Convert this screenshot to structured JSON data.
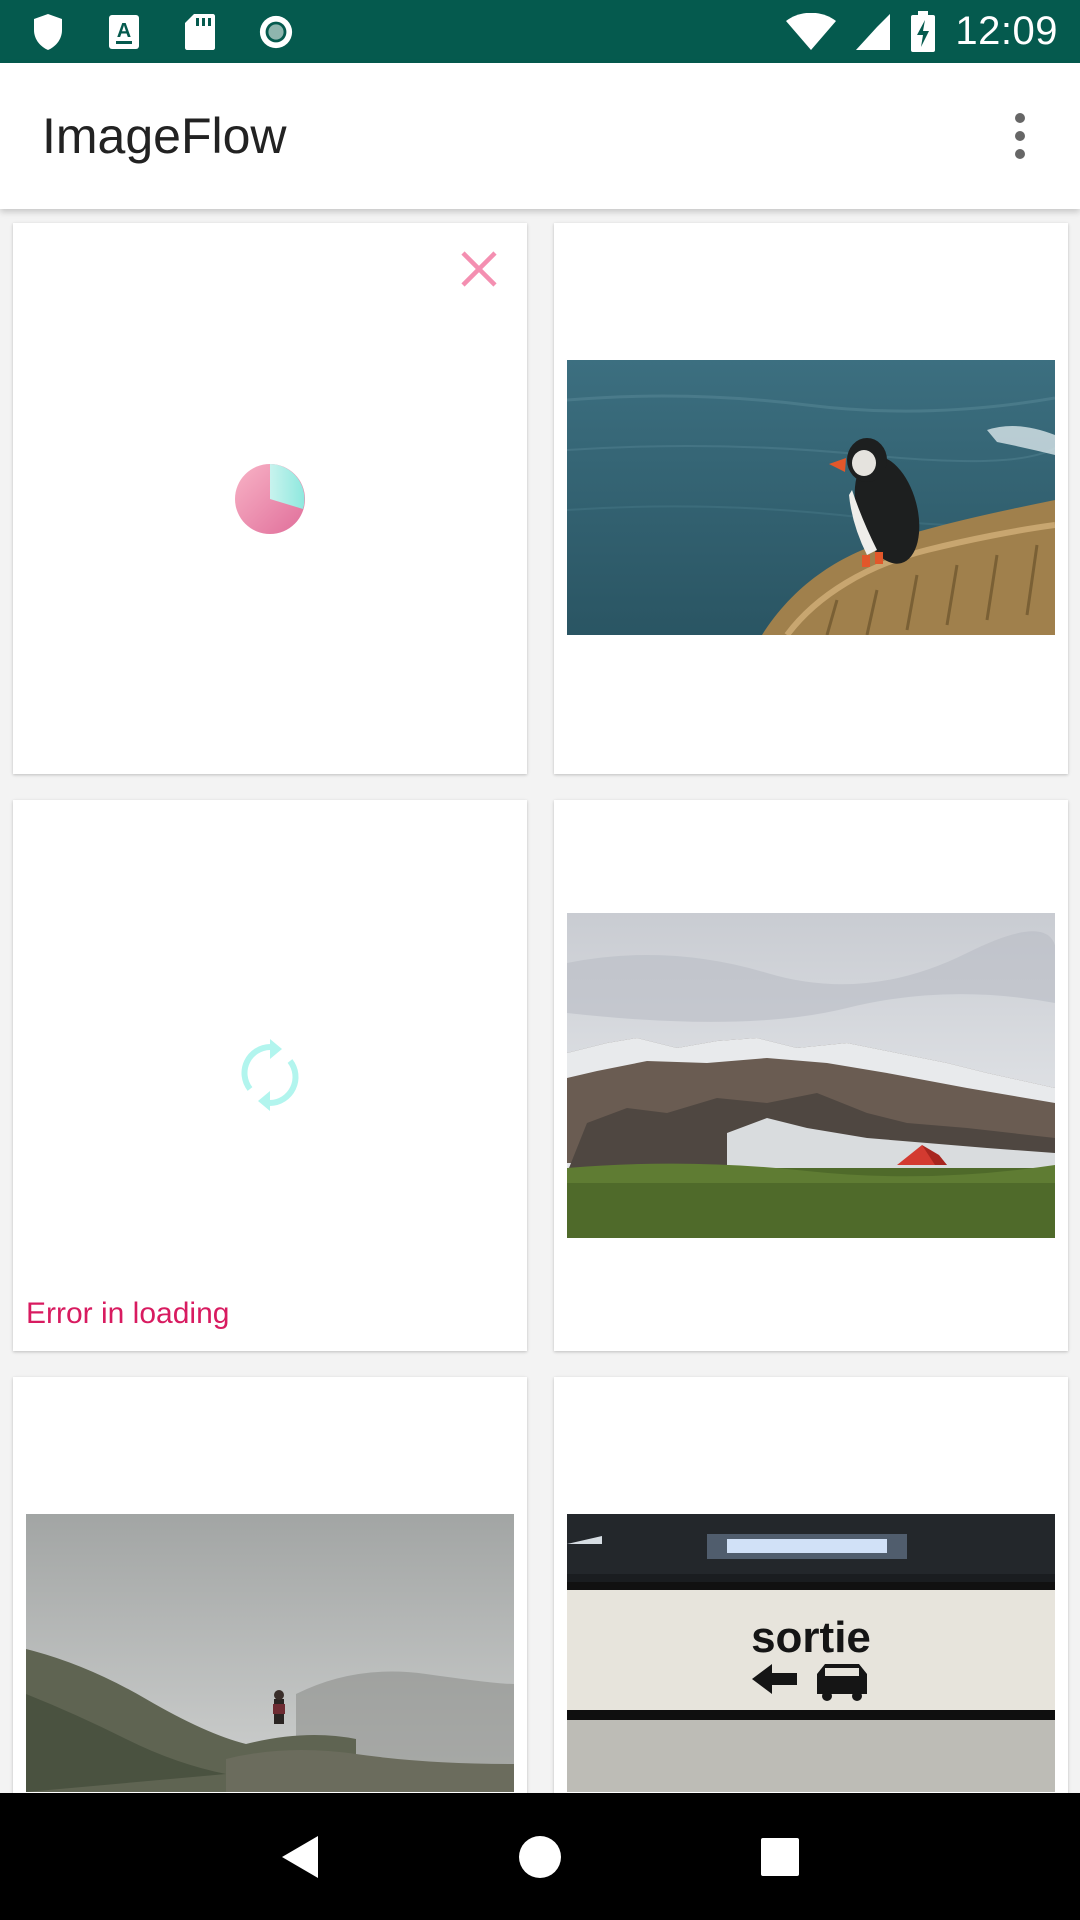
{
  "status_bar": {
    "time": "12:09",
    "left_icons": [
      "shield-icon",
      "a-badge-icon",
      "sd-card-icon",
      "record-icon"
    ],
    "right_icons": [
      "wifi-icon",
      "signal-icon",
      "battery-charging-icon"
    ],
    "background": "#055a4e"
  },
  "app_bar": {
    "title": "ImageFlow",
    "menu_icon": "overflow-menu-icon"
  },
  "grid": {
    "cards": [
      {
        "state": "loading",
        "icons": [
          "cancel-icon",
          "progress-pie-icon"
        ]
      },
      {
        "state": "loaded",
        "photo": "puffin on cliff above sea"
      },
      {
        "state": "error",
        "icons": [
          "retry-icon"
        ],
        "message": "Error in loading"
      },
      {
        "state": "loaded",
        "photo": "snowy mountains with red tent"
      },
      {
        "state": "loaded",
        "photo": "hiker in foggy hills"
      },
      {
        "state": "loaded",
        "photo": "parking garage wall sign"
      }
    ],
    "sign_text": "sortie"
  },
  "nav_bar": {
    "buttons": [
      "back-icon",
      "home-icon",
      "recents-icon"
    ]
  },
  "colors": {
    "accent": "#d81b60",
    "cancel": "#f48fb1",
    "retry": "#b2f5ee"
  }
}
